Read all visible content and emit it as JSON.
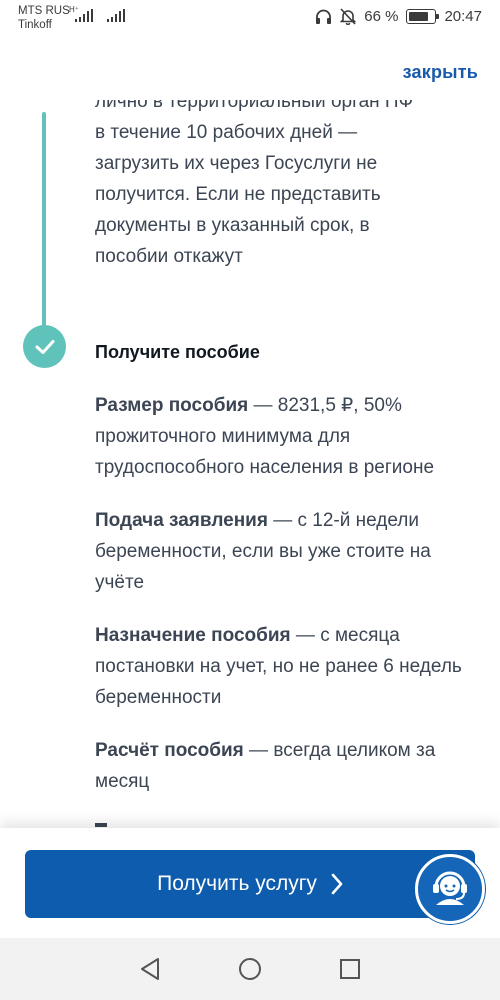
{
  "status_bar": {
    "carrier_1": "MTS RUS",
    "carrier_2": "Tinkoff",
    "battery_percent": "66 %",
    "time": "20:47",
    "icons": [
      "headphones-icon",
      "mute-icon",
      "battery-icon"
    ]
  },
  "header": {
    "close_label": "закрыть"
  },
  "previous_step": {
    "clipped_line": "лично в территориальный орган ПФ",
    "lines": [
      "в течение 10 рабочих дней —",
      "загрузить их через Госуслуги не",
      "получится. Если не представить",
      "документы в указанный срок, в",
      "пособии откажут"
    ]
  },
  "step": {
    "title": "Получите пособие",
    "paragraphs": [
      {
        "bold": "Размер пособия",
        "text": " — 8231,5 ₽, 50% прожиточного минимума для трудоспособного населения в регионе"
      },
      {
        "bold": "Подача заявления",
        "text": " — с 12-й недели беременности, если вы уже стоите на учёте"
      },
      {
        "bold": "Назначение пособия",
        "text": " — с месяца постановки на учет, но не ранее 6 недель беременности"
      },
      {
        "bold": "Расчёт пособия",
        "text": " — всегда целиком за месяц"
      }
    ]
  },
  "action": {
    "button_label": "Получить услугу",
    "support_icon": "support-agent-icon"
  },
  "navigation": {
    "icons": [
      "back-icon",
      "home-icon",
      "recents-icon"
    ]
  },
  "colors": {
    "primary_blue": "#0d5cad",
    "link_blue": "#1a5aab",
    "teal": "#5fc2bb"
  }
}
